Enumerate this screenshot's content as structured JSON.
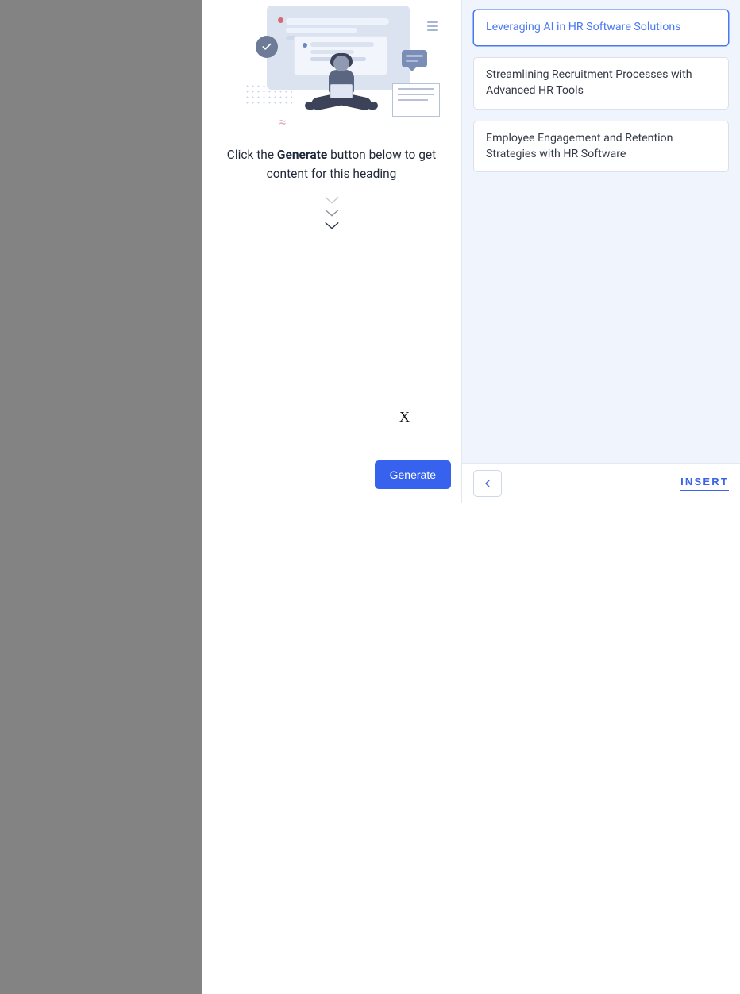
{
  "center": {
    "instruction_prefix": "Click the ",
    "instruction_bold": "Generate",
    "instruction_suffix": " button below to get content for this heading",
    "generate_label": "Generate"
  },
  "suggestions": [
    {
      "label": "Leveraging AI in HR Software Solutions"
    },
    {
      "label": "Streamlining Recruitment Processes with Advanced HR Tools"
    },
    {
      "label": "Employee Engagement and Retention Strategies with HR Software"
    }
  ],
  "footer": {
    "insert_label": "INSERT"
  },
  "watermark": "X"
}
